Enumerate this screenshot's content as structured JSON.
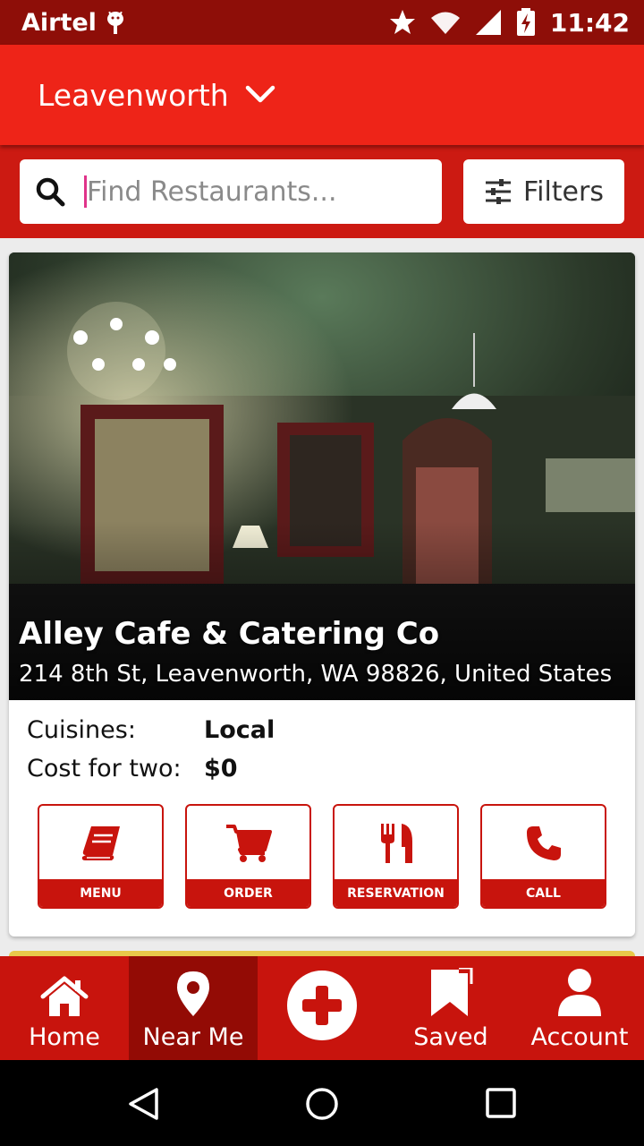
{
  "status_bar": {
    "carrier": "Airtel",
    "time": "11:42",
    "icons": [
      "android-icon",
      "star-icon",
      "wifi-icon",
      "signal-icon",
      "battery-charging-icon"
    ]
  },
  "header": {
    "city": "Leavenworth",
    "dropdown_icon": "chevron-down-icon"
  },
  "search": {
    "placeholder": "Find Restaurants...",
    "filters_label": "Filters"
  },
  "restaurant": {
    "name": "Alley Cafe & Catering Co",
    "address": "214 8th St, Leavenworth, WA 98826, United States",
    "cuisines_label": "Cuisines:",
    "cuisines_value": "Local",
    "cost_label": "Cost for two:",
    "cost_value": "$0",
    "actions": [
      {
        "label": "MENU",
        "icon": "book-icon"
      },
      {
        "label": "ORDER",
        "icon": "cart-icon"
      },
      {
        "label": "RESERVATION",
        "icon": "fork-knife-icon"
      },
      {
        "label": "CALL",
        "icon": "phone-icon"
      }
    ]
  },
  "bottom_nav": {
    "items": [
      {
        "label": "Home",
        "icon": "home-icon",
        "active": false
      },
      {
        "label": "Near Me",
        "icon": "location-pin-icon",
        "active": true
      },
      {
        "label": "",
        "icon": "add-circle-icon",
        "active": false
      },
      {
        "label": "Saved",
        "icon": "bookmark-icon",
        "active": false
      },
      {
        "label": "Account",
        "icon": "user-icon",
        "active": false
      }
    ]
  },
  "system_nav": [
    "back-icon",
    "home-circle-icon",
    "recents-icon"
  ],
  "colors": {
    "primary": "#ee2418",
    "primary_dark": "#8e0e08",
    "accent_red": "#c8140d",
    "active_nav": "#930b05"
  }
}
